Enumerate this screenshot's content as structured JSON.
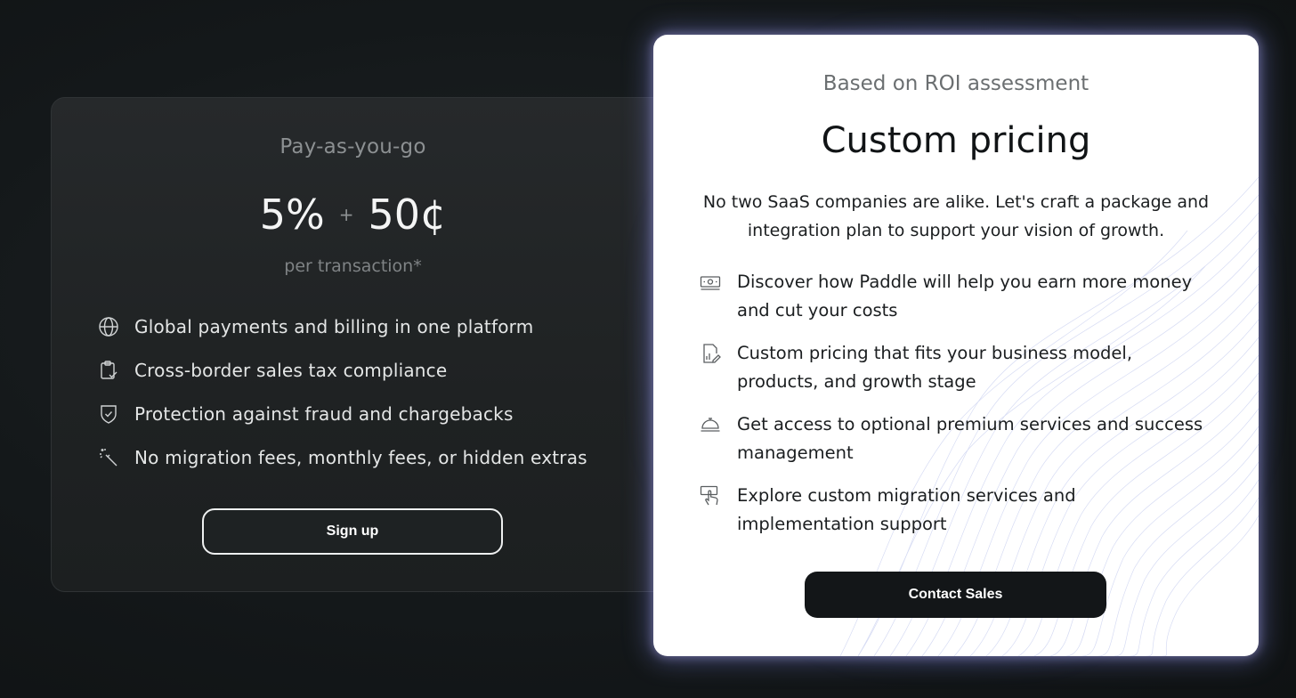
{
  "payg": {
    "label": "Pay-as-you-go",
    "percent": "5%",
    "plus": "+",
    "fee": "50¢",
    "per": "per transaction*",
    "features": [
      {
        "icon": "globe-icon",
        "text": "Global payments and billing in one platform"
      },
      {
        "icon": "clipboard-check-icon",
        "text": "Cross-border sales tax compliance"
      },
      {
        "icon": "shield-check-icon",
        "text": "Protection against fraud and chargebacks"
      },
      {
        "icon": "magic-wand-icon",
        "text": "No migration fees, monthly fees, or hidden extras"
      }
    ],
    "cta": "Sign up"
  },
  "custom": {
    "label": "Based on ROI assessment",
    "title": "Custom pricing",
    "description": "No two SaaS companies are alike. Let's craft a package and integration plan to support your vision of growth.",
    "features": [
      {
        "icon": "money-bill-icon",
        "text": "Discover how Paddle will help you earn more money and cut your costs"
      },
      {
        "icon": "document-edit-icon",
        "text": "Custom pricing that fits your business model, products, and growth stage"
      },
      {
        "icon": "service-bell-icon",
        "text": "Get access to optional premium services and success management"
      },
      {
        "icon": "hand-pointer-icon",
        "text": "Explore custom migration services and implementation support"
      }
    ],
    "cta": "Contact Sales"
  }
}
